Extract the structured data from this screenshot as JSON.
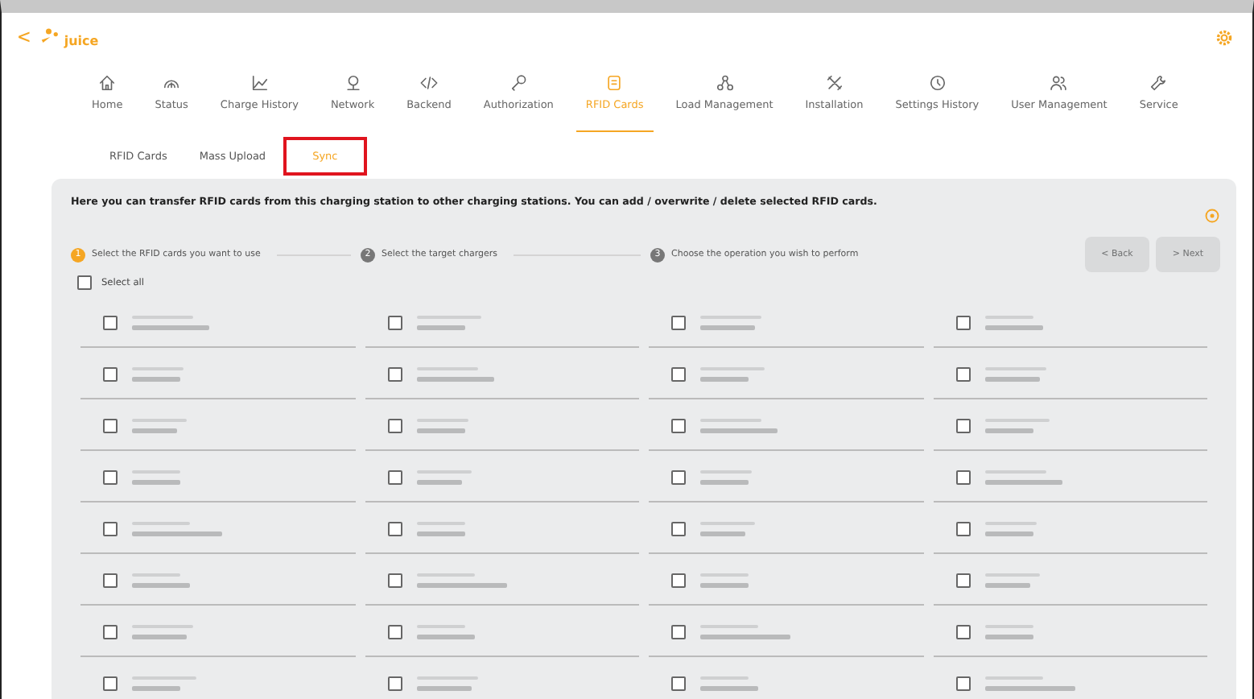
{
  "header": {
    "back": "<",
    "logo": "juice"
  },
  "nav": [
    {
      "label": "Home",
      "selected": false
    },
    {
      "label": "Status",
      "selected": false
    },
    {
      "label": "Charge History",
      "selected": false
    },
    {
      "label": "Network",
      "selected": false
    },
    {
      "label": "Backend",
      "selected": false
    },
    {
      "label": "Authorization",
      "selected": false
    },
    {
      "label": "RFID Cards",
      "selected": true
    },
    {
      "label": "Load Management",
      "selected": false
    },
    {
      "label": "Installation",
      "selected": false
    },
    {
      "label": "Settings History",
      "selected": false
    },
    {
      "label": "User Management",
      "selected": false
    },
    {
      "label": "Service",
      "selected": false
    }
  ],
  "subtabs": [
    {
      "label": "RFID Cards",
      "selected": false,
      "highlighted": false
    },
    {
      "label": "Mass Upload",
      "selected": false,
      "highlighted": false
    },
    {
      "label": "Sync",
      "selected": true,
      "highlighted": true
    }
  ],
  "description": "Here you can transfer RFID cards from this charging station to other charging stations. You can add / overwrite / delete selected RFID cards.",
  "steps": [
    {
      "number": "1",
      "label": "Select the RFID cards you want to use",
      "selected": true
    },
    {
      "number": "2",
      "label": "Select the target chargers",
      "selected": false
    },
    {
      "number": "3",
      "label": "Choose the operation you wish to perform",
      "selected": false
    }
  ],
  "buttons": [
    {
      "label": "< Back",
      "disabled": true
    },
    {
      "label": "> Next",
      "disabled": true
    }
  ],
  "select_all": {
    "label": "Select all",
    "checked": false
  },
  "cards": [
    {
      "checked": false
    },
    {
      "checked": false
    },
    {
      "checked": false
    },
    {
      "checked": false
    },
    {
      "checked": false
    },
    {
      "checked": false
    },
    {
      "checked": false
    },
    {
      "checked": false
    },
    {
      "checked": false
    },
    {
      "checked": false
    },
    {
      "checked": false
    },
    {
      "checked": false
    },
    {
      "checked": false
    },
    {
      "checked": false
    },
    {
      "checked": false
    },
    {
      "checked": false
    },
    {
      "checked": false
    },
    {
      "checked": false
    },
    {
      "checked": false
    },
    {
      "checked": false
    },
    {
      "checked": false
    },
    {
      "checked": false
    },
    {
      "checked": false
    },
    {
      "checked": false
    },
    {
      "checked": false
    },
    {
      "checked": false
    },
    {
      "checked": false
    },
    {
      "checked": false
    },
    {
      "checked": false
    },
    {
      "checked": false
    },
    {
      "checked": false
    },
    {
      "checked": false
    }
  ]
}
